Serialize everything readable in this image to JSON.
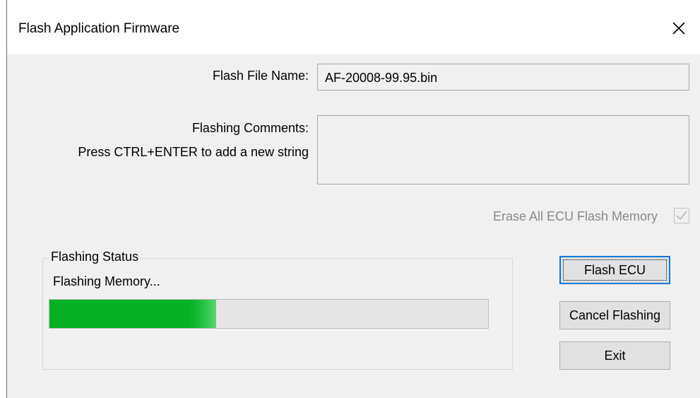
{
  "window": {
    "title": "Flash Application Firmware",
    "close_glyph": "✕"
  },
  "flash_file": {
    "label": "Flash File Name:",
    "value": "AF-20008-99.95.bin"
  },
  "comments": {
    "label": "Flashing Comments:",
    "hint": "Press CTRL+ENTER to add a new string",
    "value": ""
  },
  "erase": {
    "label": "Erase All ECU Flash Memory",
    "checked": true,
    "enabled": false
  },
  "status": {
    "group_title": "Flashing Status",
    "text": "Flashing Memory...",
    "progress_percent": 38
  },
  "buttons": {
    "flash": "Flash ECU",
    "cancel": "Cancel Flashing",
    "exit": "Exit"
  },
  "colors": {
    "progress_fill": "#06b025",
    "default_button_border": "#0078d7",
    "disabled_text": "#8a8a8a"
  }
}
